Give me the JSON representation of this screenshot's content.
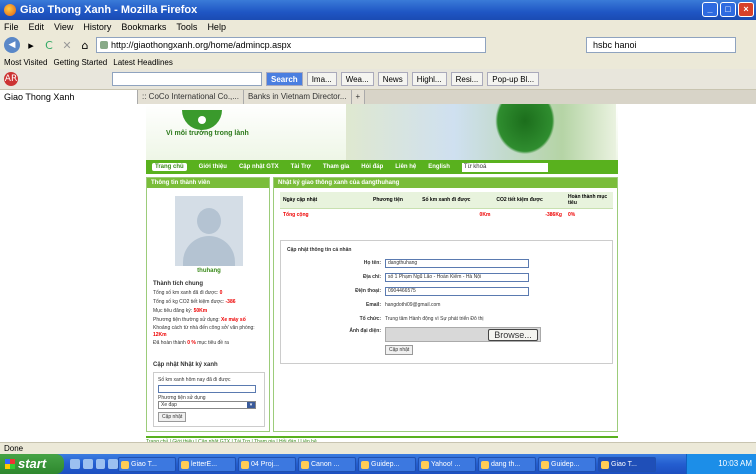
{
  "window": {
    "title": "Giao Thong Xanh - Mozilla Firefox"
  },
  "menu": [
    "File",
    "Edit",
    "View",
    "History",
    "Bookmarks",
    "Tools",
    "Help"
  ],
  "nav": {
    "url": "http://giaothongxanh.org/home/admincp.aspx",
    "search": "hsbc hanoi"
  },
  "bookmarks": [
    "Most Visited",
    "Getting Started",
    "Latest Headlines"
  ],
  "toolbar": [
    "Search",
    "Ima...",
    "Wea...",
    "News",
    "Highl...",
    "Resi...",
    "Pop-up Bl..."
  ],
  "tabs": [
    "Giao Thong Xanh",
    ":: CoCo International Co.,...",
    "Banks in Vietnam Director..."
  ],
  "site": {
    "slogan": "Vì môi trường trong lành",
    "menu": [
      "Trang chủ",
      "Giới thiệu",
      "Cập nhật GTX",
      "Tài Trợ",
      "Tham gia",
      "Hỏi đáp",
      "Liên hệ",
      "English"
    ],
    "search_text": "Từ khoá"
  },
  "member": {
    "header": "Thông tin thành viên",
    "username": "thuhang",
    "stats_title": "Thành tích chung",
    "stats": [
      {
        "label": "Tổng số km xanh đã đi được:",
        "value": "0"
      },
      {
        "label": "Tổng số kg CO2 tiết kiệm được:",
        "value": "-386"
      },
      {
        "label": "Mục tiêu đăng ký:",
        "value": "50Km"
      },
      {
        "label": "Phương tiện thường sử dụng:",
        "value": "Xe máy số"
      },
      {
        "label": "Khoảng cách từ nhà đến công sở/ văn phòng:",
        "value": "12Km"
      },
      {
        "label": "Đã hoàn thành",
        "value": "0 %",
        "suffix": "mục tiêu đề ra"
      }
    ],
    "update_title": "Cập nhật Nhật ký xanh",
    "km_label": "Số km xanh hôm nay đã đi được",
    "vehicle_label": "Phương tiện sử dụng",
    "vehicle_value": "Xe đạp",
    "update_button": "Cập nhật"
  },
  "history": {
    "header": "Nhật ký giao thông xanh của dangthuhang",
    "columns": [
      "Ngày cập nhật",
      "Phương tiện",
      "Số km xanh đi được",
      "CO2 tiết kiệm được",
      "Hoàn thành mục tiêu"
    ],
    "total": {
      "label": "Tổng cộng",
      "km": "0Km",
      "co2": "-386Kg",
      "percent": "0%"
    }
  },
  "profile": {
    "title": "Cập nhật thông tin cá nhân",
    "fields": [
      {
        "label": "Họ tên:",
        "value": "dangthuhang"
      },
      {
        "label": "Địa chỉ:",
        "value": "số 1 Phạm Ngũ Lão - Hoàn Kiếm - Hà Nội"
      },
      {
        "label": "Điện thoại:",
        "value": "0904466575"
      },
      {
        "label": "Email:",
        "value": "hangdothi09@gmail.com"
      },
      {
        "label": "Tổ chức:",
        "value": "Trung tâm Hành động vì Sự phát triển Đô thị"
      },
      {
        "label": "Ảnh đại diện:",
        "value": ""
      }
    ],
    "browse": "Browse...",
    "save": "Cập nhật"
  },
  "footer": "Trang chủ | Giới thiệu | Cập nhật GTX | Tài Trợ | Tham gia | Hỏi đáp | Liên hệ",
  "status": "Done",
  "taskbar": {
    "start": "start",
    "tasks": [
      "Giao T...",
      "letterE...",
      "04 Proj...",
      "Canon ...",
      "Guidep...",
      "Yahoo! ...",
      "dang th...",
      "Guidep...",
      "Giao T..."
    ],
    "clock": "10:03 AM"
  }
}
